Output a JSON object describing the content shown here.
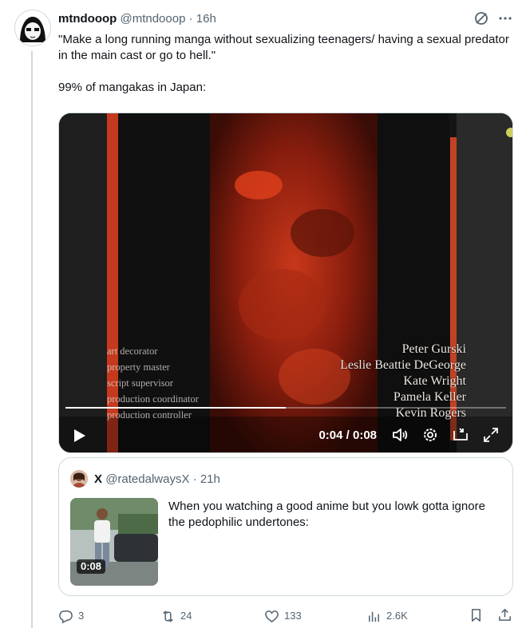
{
  "tweet": {
    "display_name": "mtndooop",
    "handle": "@mtndooop",
    "separator": "·",
    "time": "16h",
    "text_line1": "\"Make a long running manga without sexualizing teenagers/ having a sexual predator in the main cast or go to hell.\"",
    "text_line2": "99% of mangakas in Japan:"
  },
  "video": {
    "credits_left": [
      "art decorator",
      "property master",
      "script supervisor",
      "production coordinator",
      "production controller"
    ],
    "credits_right": [
      "Peter Gurski",
      "Leslie Beattie DeGeorge",
      "Kate Wright",
      "Pamela Keller",
      "Kevin Rogers"
    ],
    "time_label": "0:04 / 0:08",
    "progress": 0.5,
    "play_icon": "play-icon",
    "volume_icon": "volume-icon",
    "settings_icon": "gear-icon",
    "fullscreen_icon": "expand-icon"
  },
  "quote": {
    "display_name": "X",
    "handle": "@ratedalwaysX",
    "separator": "·",
    "time": "21h",
    "text": "When you watching a good anime but you lowk gotta ignore the pedophilic undertones:",
    "video_duration": "0:08"
  },
  "actions": {
    "replies": "3",
    "reposts": "24",
    "likes": "133",
    "views": "2.6K"
  },
  "colors": {
    "text": "#0f1419",
    "muted": "#536471",
    "border": "#cfd9de",
    "accent_red": "#e0401c"
  }
}
